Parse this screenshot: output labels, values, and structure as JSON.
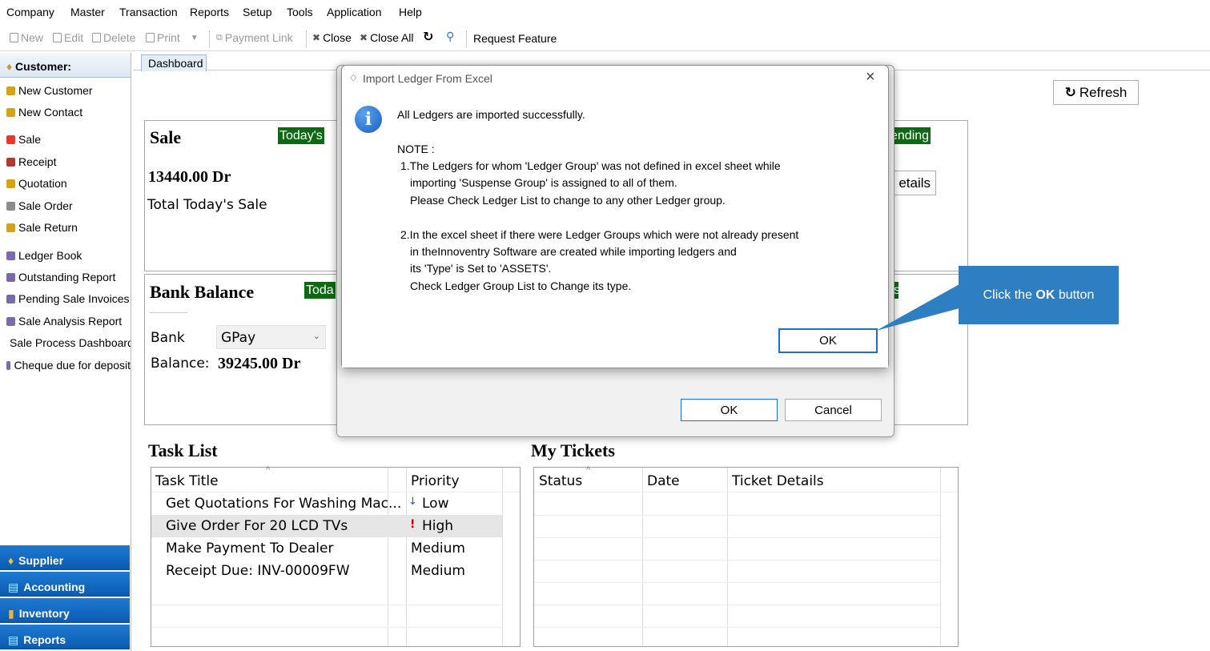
{
  "menubar": {
    "items": [
      "Company",
      "Master",
      "Transaction",
      "Reports",
      "Setup",
      "Tools",
      "Application",
      "Help"
    ]
  },
  "toolbar": {
    "new": "New",
    "edit": "Edit",
    "delete": "Delete",
    "print": "Print",
    "payment_link": "Payment Link",
    "close": "Close",
    "close_all": "Close All",
    "request_feature": "Request Feature"
  },
  "sidebar": {
    "header": "Customer:",
    "items": [
      "New Customer",
      "New Contact",
      "Sale",
      "Receipt",
      "Quotation",
      "Sale Order",
      "Sale Return",
      "Ledger Book",
      "Outstanding Report",
      "Pending Sale Invoices",
      "Sale Analysis Report",
      "Sale Process Dashboard",
      "Cheque due for deposit"
    ],
    "sections": [
      "Supplier",
      "Accounting",
      "Inventory",
      "Reports"
    ]
  },
  "tabs": {
    "dashboard": "Dashboard"
  },
  "dashboard": {
    "refresh": "Refresh",
    "sale_title": "Sale",
    "sale_badge": "Today's",
    "sale_amount": "13440.00 Dr",
    "sale_caption": "Total Today's Sale",
    "pending_badge": "ending",
    "details_button": "etails",
    "bank_title": "Bank Balance",
    "bank_badge": "Toda",
    "bank_label": "Bank",
    "bank_selected": "GPay",
    "balance_label": "Balance:",
    "balance_value": "39245.00 Dr",
    "right_badge": "s",
    "task_list_title": "Task List",
    "my_tickets_title": "My Tickets"
  },
  "task_list": {
    "columns": [
      "Task Title",
      "Priority"
    ],
    "rows": [
      {
        "title": "Get Quotations For Washing Mac...",
        "priority": "Low",
        "marker": "↓"
      },
      {
        "title": "Give Order For 20 LCD TVs",
        "priority": "High",
        "marker": "!"
      },
      {
        "title": "Make Payment To Dealer",
        "priority": "Medium",
        "marker": ""
      },
      {
        "title": "Receipt Due: INV-00009FW",
        "priority": "Medium",
        "marker": ""
      }
    ]
  },
  "tickets": {
    "columns": [
      "Status",
      "Date",
      "Ticket Details"
    ]
  },
  "back_dialog": {
    "ok": "OK",
    "cancel": "Cancel"
  },
  "dialog": {
    "title": "Import Ledger From Excel",
    "lines": [
      "All Ledgers are imported successfully.",
      "NOTE :",
      "1.The Ledgers for whom 'Ledger Group' was not defined in excel sheet while",
      "importing 'Suspense Group' is assigned  to all of them.",
      "Please Check Ledger List to change to any other Ledger group.",
      "2.In the excel sheet if there were Ledger Groups which were not already present",
      "in theInnoventry Software are created while importing ledgers and",
      "its 'Type' is Set to 'ASSETS'.",
      "Check Ledger Group List to Change its type."
    ],
    "ok": "OK"
  },
  "callout": {
    "prefix": "Click the ",
    "bold": "OK",
    "suffix": " button"
  },
  "colors": {
    "accent_blue": "#0a5cb0",
    "badge_green": "#0c6b12",
    "callout_blue": "#2e7ec2",
    "high_red": "#d10000"
  }
}
